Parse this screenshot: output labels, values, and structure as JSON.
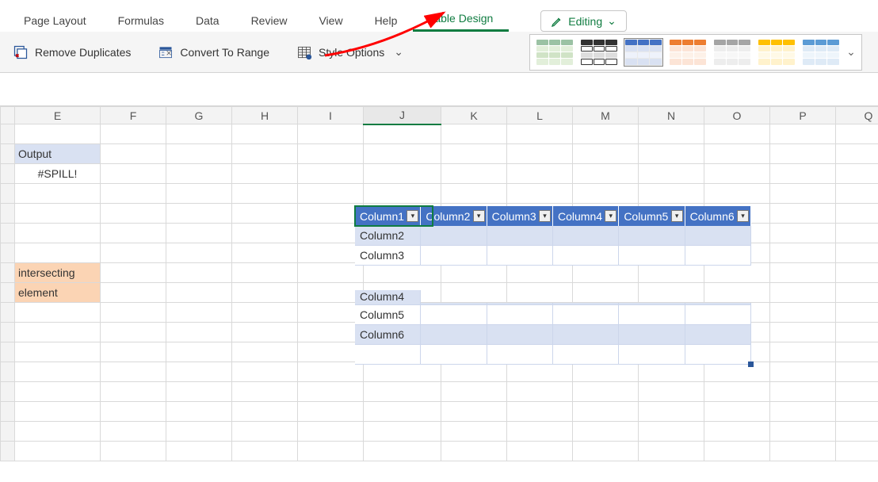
{
  "ribbon": {
    "tabs": [
      "Page Layout",
      "Formulas",
      "Data",
      "Review",
      "View",
      "Help",
      "Table Design"
    ],
    "active_tab": "Table Design",
    "editing_label": "Editing"
  },
  "toolbar": {
    "remove_duplicates": "Remove Duplicates",
    "convert_to_range": "Convert To Range",
    "style_options": "Style Options"
  },
  "columns": [
    "E",
    "F",
    "G",
    "H",
    "I",
    "J",
    "K",
    "L",
    "M",
    "N",
    "O",
    "P",
    "Q"
  ],
  "cells": {
    "output_label": "Output",
    "spill_error": "#SPILL!",
    "intersecting": "intersecting",
    "element": "element"
  },
  "table": {
    "headers": [
      "Column1",
      "Column2",
      "Column3",
      "Column4",
      "Column5",
      "Column6"
    ],
    "rows": [
      "Column2",
      "Column3",
      "Column4",
      "Column5",
      "Column6"
    ]
  }
}
